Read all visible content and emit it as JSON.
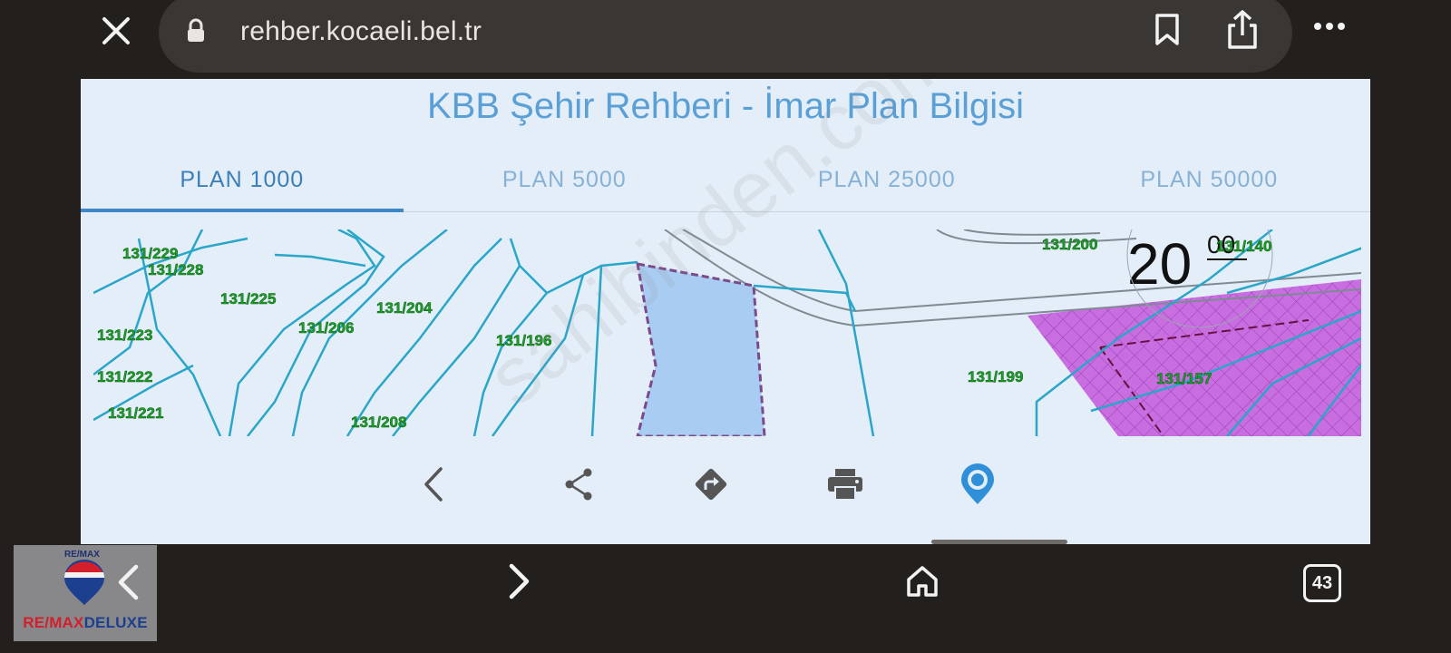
{
  "browser": {
    "url": "rehber.kocaeli.bel.tr",
    "tab_count": "43"
  },
  "page": {
    "title": "KBB Şehir Rehberi - İmar Plan Bilgisi",
    "tabs": [
      {
        "label": "PLAN 1000",
        "active": true
      },
      {
        "label": "PLAN 5000",
        "active": false
      },
      {
        "label": "PLAN 25000",
        "active": false
      },
      {
        "label": "PLAN 50000",
        "active": false
      }
    ]
  },
  "map": {
    "parcels": [
      "131/229",
      "131/228",
      "131/225",
      "131/223",
      "131/206",
      "131/204",
      "131/222",
      "131/221",
      "131/208",
      "131/196",
      "131/200",
      "131/140",
      "131/199",
      "131/157"
    ],
    "road_label": "20",
    "road_label_sup": "00",
    "colors": {
      "parcel_line": "#2aa6c8",
      "parcel_label": "#1e9f2a",
      "selected_fill": "#a9cdf2",
      "zone_fill": "#c86ee0"
    }
  },
  "toolbar": {
    "icons": [
      "back-icon",
      "share-icon",
      "directions-icon",
      "print-icon",
      "location-pin-icon"
    ]
  },
  "watermark": "sahibinden.com",
  "logo": {
    "top_text": "RE/MAX",
    "brand_red": "RE/MAX",
    "brand_blue": "DELUXE"
  }
}
